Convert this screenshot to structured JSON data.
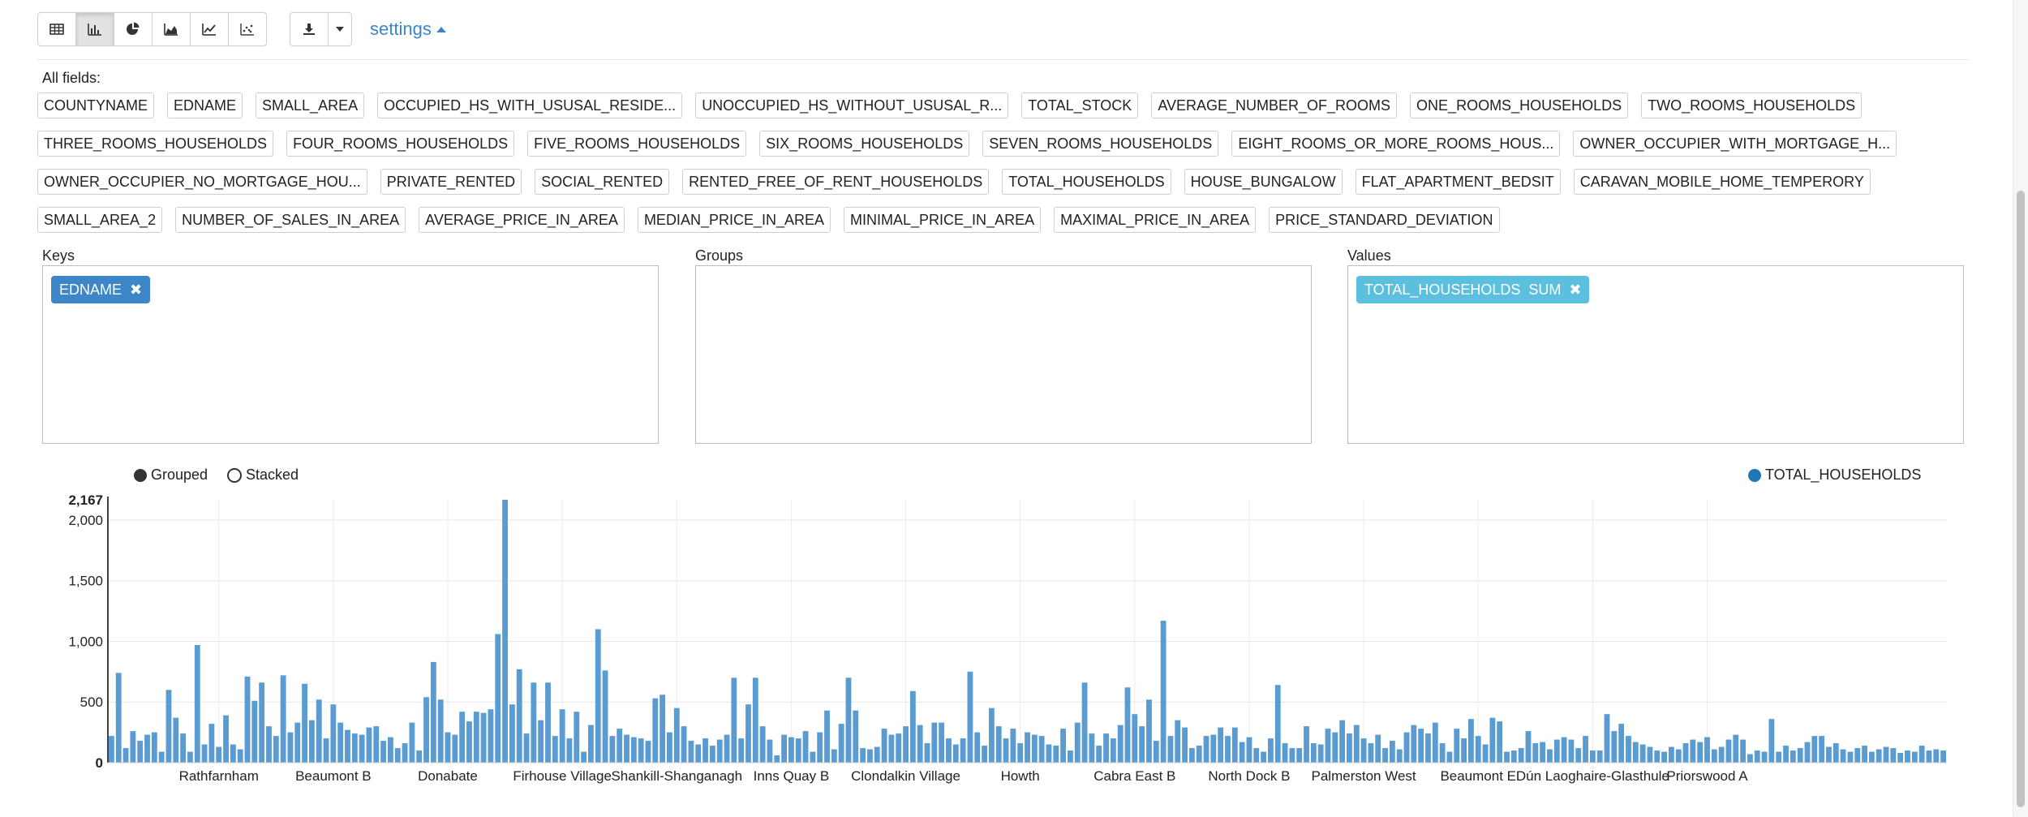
{
  "toolbar": {
    "view_buttons": [
      {
        "icon": "table-icon"
      },
      {
        "icon": "bar-chart-icon",
        "active": true
      },
      {
        "icon": "pie-chart-icon"
      },
      {
        "icon": "area-chart-icon"
      },
      {
        "icon": "line-chart-icon"
      },
      {
        "icon": "scatter-chart-icon"
      }
    ],
    "download_icon": "download-icon",
    "settings_label": "settings"
  },
  "fields": {
    "label": "All fields:",
    "items": [
      "COUNTYNAME",
      "EDNAME",
      "SMALL_AREA",
      "OCCUPIED_HS_WITH_USUSAL_RESIDE...",
      "UNOCCUPIED_HS_WITHOUT_USUSAL_R...",
      "TOTAL_STOCK",
      "AVERAGE_NUMBER_OF_ROOMS",
      "ONE_ROOMS_HOUSEHOLDS",
      "TWO_ROOMS_HOUSEHOLDS",
      "THREE_ROOMS_HOUSEHOLDS",
      "FOUR_ROOMS_HOUSEHOLDS",
      "FIVE_ROOMS_HOUSEHOLDS",
      "SIX_ROOMS_HOUSEHOLDS",
      "SEVEN_ROOMS_HOUSEHOLDS",
      "EIGHT_ROOMS_OR_MORE_ROOMS_HOUS...",
      "OWNER_OCCUPIER_WITH_MORTGAGE_H...",
      "OWNER_OCCUPIER_NO_MORTGAGE_HOU...",
      "PRIVATE_RENTED",
      "SOCIAL_RENTED",
      "RENTED_FREE_OF_RENT_HOUSEHOLDS",
      "TOTAL_HOUSEHOLDS",
      "HOUSE_BUNGALOW",
      "FLAT_APARTMENT_BEDSIT",
      "CARAVAN_MOBILE_HOME_TEMPERORY",
      "SMALL_AREA_2",
      "NUMBER_OF_SALES_IN_AREA",
      "AVERAGE_PRICE_IN_AREA",
      "MEDIAN_PRICE_IN_AREA",
      "MINIMAL_PRICE_IN_AREA",
      "MAXIMAL_PRICE_IN_AREA",
      "PRICE_STANDARD_DEVIATION"
    ]
  },
  "zones": {
    "keys": {
      "label": "Keys",
      "tags": [
        "EDNAME"
      ]
    },
    "groups": {
      "label": "Groups",
      "tags": []
    },
    "values": {
      "label": "Values",
      "tags": [
        "TOTAL_HOUSEHOLDS  SUM"
      ]
    }
  },
  "chart_controls": {
    "grouped_label": "Grouped",
    "stacked_label": "Stacked",
    "mode": "grouped"
  },
  "chart_data": {
    "type": "bar",
    "series": [
      {
        "name": "TOTAL_HOUSEHOLDS",
        "color": "#5a9bd1"
      }
    ],
    "y_ticks": [
      "0",
      "500",
      "1,000",
      "1,500",
      "2,000"
    ],
    "y_max_label": "2,167",
    "ylim": [
      0,
      2167
    ],
    "grid": true,
    "legend_position": "top-right",
    "x_tick_labels": [
      {
        "label": "Rathfarnham",
        "index": 15
      },
      {
        "label": "Beaumont B",
        "index": 31
      },
      {
        "label": "Donabate",
        "index": 47
      },
      {
        "label": "Firhouse Village",
        "index": 63
      },
      {
        "label": "Shankill-Shanganagh",
        "index": 79
      },
      {
        "label": "Inns Quay B",
        "index": 95
      },
      {
        "label": "Clondalkin Village",
        "index": 111
      },
      {
        "label": "Howth",
        "index": 127
      },
      {
        "label": "Cabra East B",
        "index": 143
      },
      {
        "label": "North Dock B",
        "index": 159
      },
      {
        "label": "Palmerston West",
        "index": 175
      },
      {
        "label": "Beaumont E",
        "index": 191
      },
      {
        "label": "Dún Laoghaire-Glasthule",
        "index": 207
      },
      {
        "label": "Priorswood A",
        "index": 223
      }
    ],
    "values": [
      220,
      740,
      120,
      260,
      180,
      230,
      250,
      90,
      600,
      370,
      240,
      90,
      970,
      150,
      320,
      130,
      390,
      150,
      110,
      710,
      510,
      660,
      300,
      220,
      720,
      250,
      330,
      650,
      350,
      520,
      200,
      480,
      330,
      270,
      240,
      230,
      290,
      300,
      180,
      210,
      120,
      160,
      330,
      100,
      540,
      830,
      520,
      250,
      230,
      420,
      340,
      420,
      410,
      440,
      1060,
      2167,
      480,
      770,
      240,
      660,
      350,
      660,
      220,
      440,
      200,
      420,
      90,
      310,
      1100,
      760,
      220,
      280,
      230,
      210,
      200,
      180,
      530,
      560,
      250,
      450,
      300,
      180,
      150,
      200,
      140,
      190,
      230,
      700,
      200,
      480,
      700,
      300,
      190,
      60,
      230,
      210,
      200,
      260,
      90,
      250,
      430,
      110,
      320,
      700,
      430,
      120,
      110,
      130,
      280,
      230,
      240,
      300,
      590,
      310,
      160,
      330,
      330,
      200,
      150,
      200,
      750,
      250,
      140,
      450,
      300,
      200,
      280,
      160,
      250,
      230,
      220,
      150,
      140,
      280,
      100,
      330,
      660,
      240,
      140,
      240,
      200,
      310,
      620,
      400,
      300,
      520,
      180,
      1170,
      220,
      350,
      290,
      120,
      140,
      220,
      230,
      290,
      220,
      290,
      170,
      210,
      120,
      90,
      200,
      640,
      160,
      120,
      120,
      300,
      160,
      150,
      280,
      250,
      350,
      240,
      310,
      200,
      160,
      230,
      120,
      180,
      110,
      250,
      310,
      280,
      240,
      330,
      160,
      90,
      280,
      200,
      360,
      220,
      150,
      370,
      340,
      90,
      100,
      120,
      260,
      160,
      170,
      110,
      190,
      210,
      190,
      120,
      220,
      100,
      100,
      400,
      260,
      320,
      220,
      170,
      150,
      130,
      100,
      90,
      130,
      110,
      160,
      190,
      170,
      210,
      110,
      130,
      190,
      230,
      190,
      70,
      100,
      90,
      360,
      90,
      140,
      100,
      120,
      170,
      220,
      220,
      130,
      160,
      110,
      90,
      120,
      140,
      90,
      110,
      130,
      120,
      80,
      100,
      90,
      140,
      100,
      110,
      100
    ],
    "series_legend": "TOTAL_HOUSEHOLDS"
  }
}
